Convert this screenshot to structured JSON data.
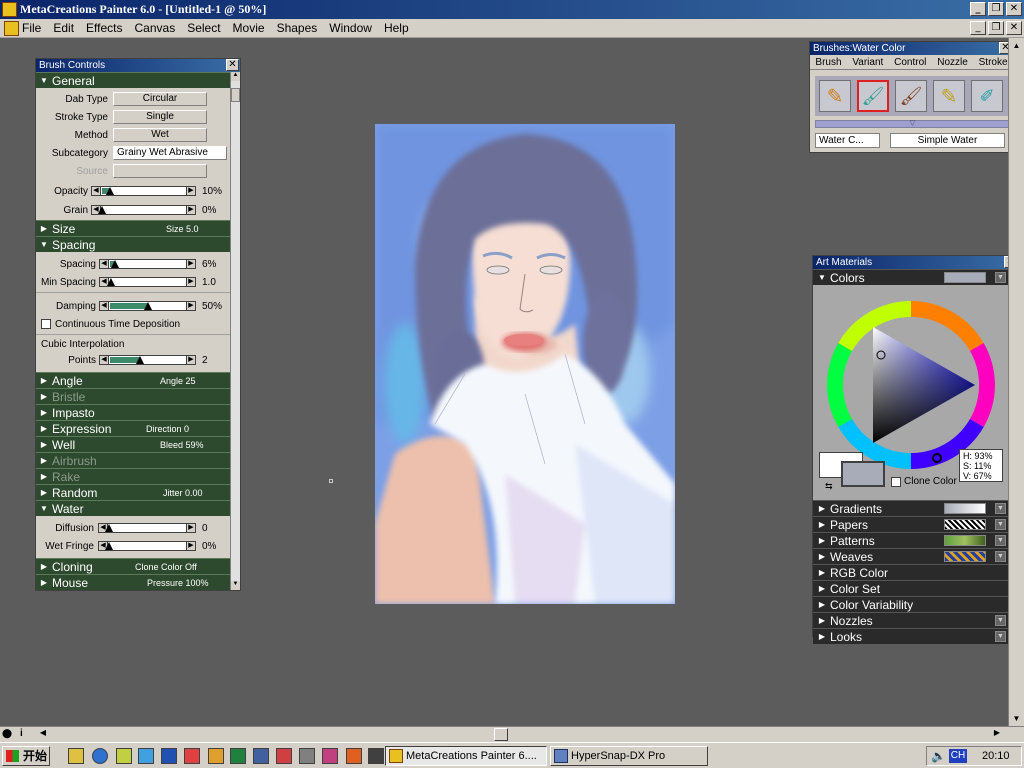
{
  "app": {
    "title": "MetaCreations Painter 6.0 - [Untitled-1 @ 50%]",
    "min": "_",
    "max": "❐",
    "close": "✕"
  },
  "menu": [
    "File",
    "Edit",
    "Effects",
    "Canvas",
    "Select",
    "Movie",
    "Shapes",
    "Window",
    "Help"
  ],
  "brush_controls": {
    "title": "Brush Controls",
    "general": "General",
    "dab_type_label": "Dab Type",
    "dab_type": "Circular",
    "stroke_type_label": "Stroke Type",
    "stroke_type": "Single",
    "method_label": "Method",
    "method": "Wet",
    "subcategory_label": "Subcategory",
    "subcategory": "Grainy Wet Abrasive",
    "source_label": "Source",
    "opacity_label": "Opacity",
    "opacity": "10%",
    "opacity_level": 0.1,
    "grain_label": "Grain",
    "grain": "0%",
    "grain_level": 0,
    "size": "Size",
    "size_val": "Size 5.0",
    "spacing": "Spacing",
    "spacing_label": "Spacing",
    "spacing_val": "6%",
    "spacing_level": 0.06,
    "min_spacing_label": "Min Spacing",
    "min_spacing_val": "1.0",
    "min_spacing_level": 0.01,
    "damping_label": "Damping",
    "damping_val": "50%",
    "damping_level": 0.5,
    "continuous": "Continuous Time Deposition",
    "cubic": "Cubic Interpolation",
    "points_label": "Points",
    "points_val": "2",
    "points_level": 0.4,
    "angle": "Angle",
    "angle_val": "Angle 25",
    "bristle": "Bristle",
    "impasto": "Impasto",
    "expression": "Expression",
    "expression_val": "Direction 0",
    "well": "Well",
    "well_val": "Bleed 59%",
    "airbrush": "Airbrush",
    "rake": "Rake",
    "random": "Random",
    "random_val": "Jitter 0.00",
    "water": "Water",
    "diffusion_label": "Diffusion",
    "diffusion_val": "0",
    "diffusion_level": 0,
    "wet_fringe_label": "Wet Fringe",
    "wet_fringe_val": "0%",
    "wet_fringe_level": 0,
    "cloning": "Cloning",
    "cloning_val": "Clone Color Off",
    "mouse": "Mouse",
    "mouse_val": "Pressure 100%"
  },
  "brushes": {
    "title": "Brushes:Water Color",
    "tabs": [
      "Brush",
      "Variant",
      "Control",
      "Nozzle",
      "Stroke"
    ],
    "category": "Water C...",
    "variant": "Simple Water"
  },
  "art_materials": {
    "title": "Art Materials",
    "colors": "Colors",
    "clone_color": "Clone Color",
    "hsv": [
      "H: 93%",
      "S: 11%",
      "V: 67%"
    ],
    "sections": [
      "Gradients",
      "Papers",
      "Patterns",
      "Weaves",
      "RGB Color",
      "Color Set",
      "Color Variability",
      "Nozzles",
      "Looks"
    ]
  },
  "taskbar": {
    "start": "开始",
    "task1": "MetaCreations Painter 6....",
    "task2": "HyperSnap-DX Pro",
    "lang": "CH",
    "time": "20:10"
  }
}
